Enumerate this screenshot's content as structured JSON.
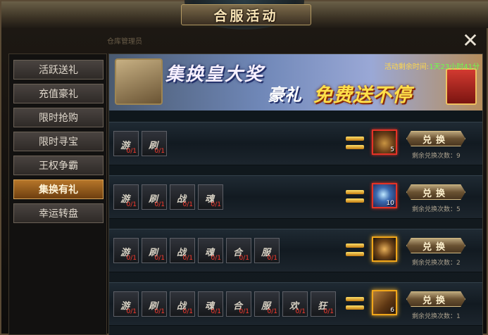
{
  "window": {
    "title": "合服活动",
    "close_label": "✕",
    "ghost_text": "仓库管理员"
  },
  "sidebar": {
    "items": [
      {
        "label": "活跃送礼",
        "active": false
      },
      {
        "label": "充值豪礼",
        "active": false
      },
      {
        "label": "限时抢购",
        "active": false
      },
      {
        "label": "限时寻宝",
        "active": false
      },
      {
        "label": "王权争霸",
        "active": false
      },
      {
        "label": "集换有礼",
        "active": true
      },
      {
        "label": "幸运转盘",
        "active": false
      }
    ]
  },
  "banner": {
    "title": "集换皇大奖",
    "subtitle_a": "豪礼",
    "subtitle_b": "免费送不停",
    "timer_label": "活动剩余时间:",
    "timer_value": "1天23小时41分"
  },
  "rows": [
    {
      "slots": [
        {
          "char": "游",
          "count": "0/1"
        },
        {
          "char": "刷",
          "count": "0/1"
        }
      ],
      "reward_count": "5",
      "button_label": "兑换",
      "remaining": "剩余兑换次数：9"
    },
    {
      "slots": [
        {
          "char": "游",
          "count": "0/1"
        },
        {
          "char": "刷",
          "count": "0/1"
        },
        {
          "char": "战",
          "count": "0/1"
        },
        {
          "char": "魂",
          "count": "0/1"
        }
      ],
      "reward_count": "10",
      "button_label": "兑换",
      "remaining": "剩余兑换次数：5"
    },
    {
      "slots": [
        {
          "char": "游",
          "count": "0/1"
        },
        {
          "char": "刷",
          "count": "0/1"
        },
        {
          "char": "战",
          "count": "0/1"
        },
        {
          "char": "魂",
          "count": "0/1"
        },
        {
          "char": "合",
          "count": "0/1"
        },
        {
          "char": "服",
          "count": "0/1"
        }
      ],
      "reward_count": "",
      "button_label": "兑换",
      "remaining": "剩余兑换次数：2"
    },
    {
      "slots": [
        {
          "char": "游",
          "count": "0/1"
        },
        {
          "char": "刷",
          "count": "0/1"
        },
        {
          "char": "战",
          "count": "0/1"
        },
        {
          "char": "魂",
          "count": "0/1"
        },
        {
          "char": "合",
          "count": "0/1"
        },
        {
          "char": "服",
          "count": "0/1"
        },
        {
          "char": "欢",
          "count": "0/1"
        },
        {
          "char": "狂",
          "count": "0/1"
        }
      ],
      "reward_count": "6",
      "button_label": "兑换",
      "remaining": "剩余兑换次数：1"
    }
  ]
}
